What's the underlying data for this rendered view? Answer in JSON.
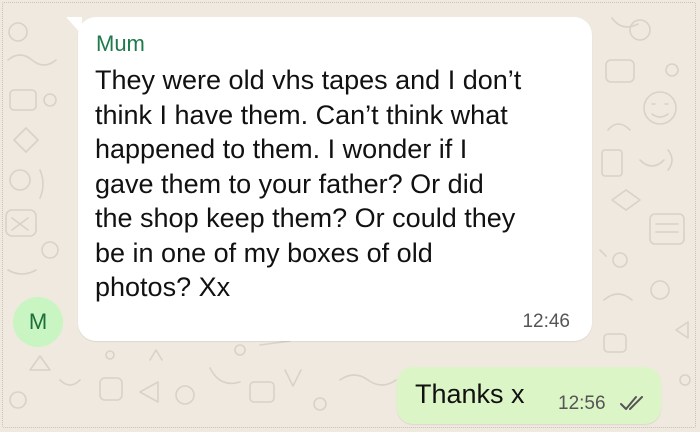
{
  "chat": {
    "incoming": {
      "sender_name": "Mum",
      "text": "They were old vhs tapes and I don’t\nthink I have them. Can’t think what\nhappened to them. I wonder if I\ngave them to your father? Or did\nthe shop keep them? Or could they\nbe in one of my boxes of old\nphotos? Xx",
      "time": "12:46",
      "avatar_initial": "M"
    },
    "outgoing": {
      "text": "Thanks x",
      "time": "12:56",
      "status_icon": "double-check-icon"
    }
  },
  "colors": {
    "sender_name": "#1e7a4c",
    "incoming_bubble": "#ffffff",
    "outgoing_bubble": "#dcf5c6",
    "avatar_bg": "#c8f5c2",
    "background": "#efe9df"
  }
}
